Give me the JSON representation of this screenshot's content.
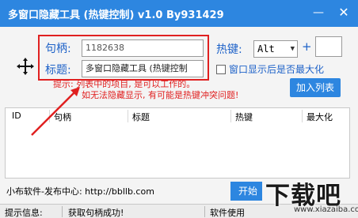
{
  "window": {
    "title": "多窗口隐藏工具 (热键控制)  v1.0 By931429",
    "minimize_glyph": "—",
    "close_glyph": "✕"
  },
  "form": {
    "handle_label": "句柄:",
    "handle_value": "1182638",
    "title_label": "标题:",
    "title_value": "多窗口隐藏工具 (热键控制",
    "hotkey_label": "热键:",
    "hotkey_value": "Alt",
    "plus": "+",
    "checkbox_label": "窗口显示后是否最大化",
    "add_button": "加入列表"
  },
  "tips": {
    "line1": "提示: 列表中的项目, 是可以工作的。",
    "line2": "如无法隐藏显示, 有可能是热键冲突问题!"
  },
  "table": {
    "columns": [
      "ID",
      "句柄",
      "标题",
      "热键",
      "最大化"
    ],
    "rows": []
  },
  "footer": {
    "site_text": "小布软件-发布中心: http://bbllb.com",
    "start_button": "开始"
  },
  "statusbar": {
    "label": "提示信息:",
    "message": "获取句柄成功!",
    "right": "软件使用"
  },
  "watermark": {
    "big": "下载吧",
    "small": "www.xiazaiba.com"
  },
  "colors": {
    "titlebar": "#2d86e0",
    "label_blue": "#1e62c8",
    "annotation_red": "#e02020"
  },
  "icons": [
    "crosshair-icon",
    "annotation-arrow-icon",
    "dropdown-arrow-icon"
  ]
}
